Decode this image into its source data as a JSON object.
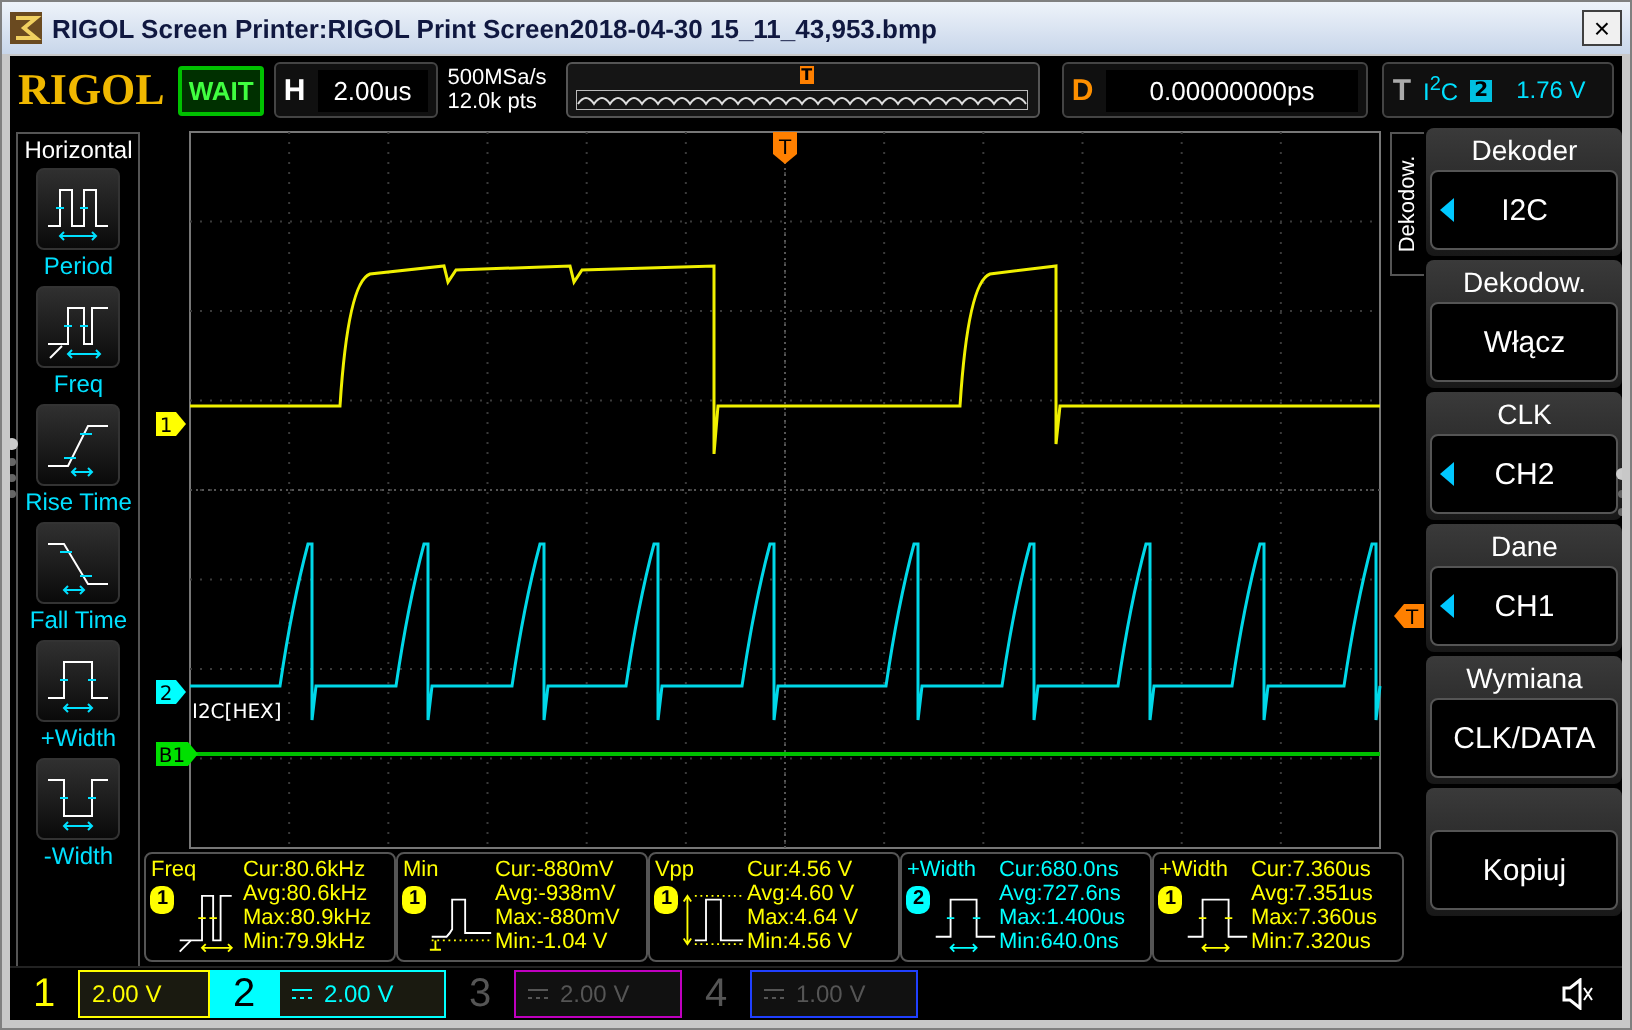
{
  "window": {
    "title": "RIGOL Screen Printer:RIGOL Print Screen2018-04-30 15_11_43,953.bmp",
    "close": "×"
  },
  "top_bar": {
    "logo": "RIGOL",
    "run_status": "WAIT",
    "horizontal": {
      "label": "H",
      "value": "2.00us"
    },
    "sample_rate": "500MSa/s",
    "memory_depth": "12.0k pts",
    "overview_marker": "T",
    "delay": {
      "label": "D",
      "value": "0.00000000ps"
    },
    "trigger": {
      "label": "T",
      "source": "I$^{2}$C",
      "channel": "2",
      "level": "1.76 V"
    }
  },
  "left_menu": {
    "title": "Horizontal",
    "items": [
      {
        "label": "Period",
        "kind": "period"
      },
      {
        "label": "Freq",
        "kind": "freq"
      },
      {
        "label": "Rise Time",
        "kind": "rise"
      },
      {
        "label": "Fall Time",
        "kind": "fall"
      },
      {
        "label": "+Width",
        "kind": "pwidth"
      },
      {
        "label": "-Width",
        "kind": "nwidth"
      }
    ]
  },
  "plot": {
    "markers": [
      {
        "label": "1",
        "color": "#ffff00"
      },
      {
        "label": "2",
        "color": "#00ffff"
      },
      {
        "label": "B1",
        "color": "#00e000"
      }
    ],
    "trigger_marker": "T",
    "trigger_level_marker": "T",
    "decode_label": "I2C[HEX]"
  },
  "right_menu": {
    "tab": "Dekodow.",
    "items": [
      {
        "title": "Dekoder",
        "value": "I2C",
        "arrow": true
      },
      {
        "title": "Dekodow.",
        "value": "Włącz",
        "arrow": false
      },
      {
        "title": "CLK",
        "value": "CH2",
        "arrow": true
      },
      {
        "title": "Dane",
        "value": "CH1",
        "arrow": true
      },
      {
        "title": "Wymiana",
        "value": "CLK/DATA",
        "arrow": false
      },
      {
        "value": "Kopiuj",
        "arrow": false
      }
    ]
  },
  "measurements": [
    {
      "name": "Freq",
      "channel": "1",
      "color": "#ffff00",
      "kind": "freq",
      "readings": [
        "Cur:80.6kHz",
        "Avg:80.6kHz",
        "Max:80.9kHz",
        "Min:79.9kHz"
      ]
    },
    {
      "name": "Min",
      "channel": "1",
      "color": "#ffff00",
      "kind": "min",
      "readings": [
        "Cur:-880mV",
        "Avg:-938mV",
        "Max:-880mV",
        "Min:-1.04 V"
      ]
    },
    {
      "name": "Vpp",
      "channel": "1",
      "color": "#ffff00",
      "kind": "vpp",
      "readings": [
        "Cur:4.56 V",
        "Avg:4.60 V",
        "Max:4.64 V",
        "Min:4.56 V"
      ]
    },
    {
      "name": "+Width",
      "channel": "2",
      "color": "#00ffff",
      "kind": "pwidth",
      "readings": [
        "Cur:680.0ns",
        "Avg:727.6ns",
        "Max:1.400us",
        "Min:640.0ns"
      ]
    },
    {
      "name": "+Width",
      "channel": "1",
      "color": "#ffff00",
      "kind": "pwidth",
      "readings": [
        "Cur:7.360us",
        "Avg:7.351us",
        "Max:7.360us",
        "Min:7.320us"
      ]
    }
  ],
  "channels": [
    {
      "number": "1",
      "value": "2.00 V",
      "color": "#ffff00",
      "enabled": true,
      "selected": false,
      "coupling_icon": false
    },
    {
      "number": "2",
      "value": "2.00 V",
      "color": "#00ffff",
      "enabled": true,
      "selected": true,
      "coupling_icon": true
    },
    {
      "number": "3",
      "value": "2.00 V",
      "color": "#c000c0",
      "enabled": false,
      "selected": false,
      "coupling_icon": true
    },
    {
      "number": "4",
      "value": "1.00 V",
      "color": "#2040ff",
      "enabled": false,
      "selected": false,
      "coupling_icon": true
    }
  ]
}
